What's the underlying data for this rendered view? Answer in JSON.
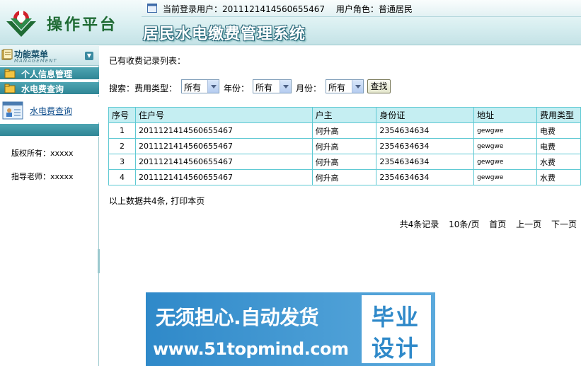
{
  "header": {
    "platform_title": "操作平台",
    "system_title": "居民水电缴费管理系统",
    "current_user_label": "当前登录用户：2011121414560655467",
    "role_label": "用户角色：普通居民"
  },
  "sidebar": {
    "menu_title": "功能菜单",
    "menu_subtitle": "MANAGEMENT",
    "groups": [
      {
        "label": "个人信息管理"
      },
      {
        "label": "水电费查询"
      }
    ],
    "sub_item": "水电费查询",
    "copyright": "版权所有：xxxxx",
    "advisor": "指导老师：xxxxx"
  },
  "main": {
    "list_title": "已有收费记录列表：",
    "search": {
      "label": "搜索：",
      "fee_type_label": "费用类型：",
      "fee_type_value": "所有",
      "year_label": "年份：",
      "year_value": "所有",
      "month_label": "月份：",
      "month_value": "所有",
      "button": "查找"
    },
    "table": {
      "headers": [
        "序号",
        "住户号",
        "户主",
        "身份证",
        "地址",
        "费用类型"
      ],
      "rows": [
        [
          "1",
          "2011121414560655467",
          "何升高",
          "2354634634",
          "gewgwe",
          "电费"
        ],
        [
          "2",
          "2011121414560655467",
          "何升高",
          "2354634634",
          "gewgwe",
          "电费"
        ],
        [
          "3",
          "2011121414560655467",
          "何升高",
          "2354634634",
          "gewgwe",
          "水费"
        ],
        [
          "4",
          "2011121414560655467",
          "何升高",
          "2354634634",
          "gewgwe",
          "水费"
        ]
      ]
    },
    "summary": "以上数据共4条, 打印本页",
    "pager": {
      "total": "共4条记录",
      "per_page": "10条/页",
      "first": "首页",
      "prev": "上一页",
      "next": "下一页"
    }
  },
  "banner": {
    "line1": "无须担心.自动发货",
    "line2": "www.51topmind.com",
    "word1": "毕业",
    "word2": "设计"
  },
  "colors": {
    "accent_teal": "#2f8595",
    "table_border": "#5ec9d3",
    "table_header_bg": "#c5eef2",
    "banner_blue": "#2f89c9",
    "logo_green": "#1f6b34",
    "logo_red": "#d2202a"
  }
}
